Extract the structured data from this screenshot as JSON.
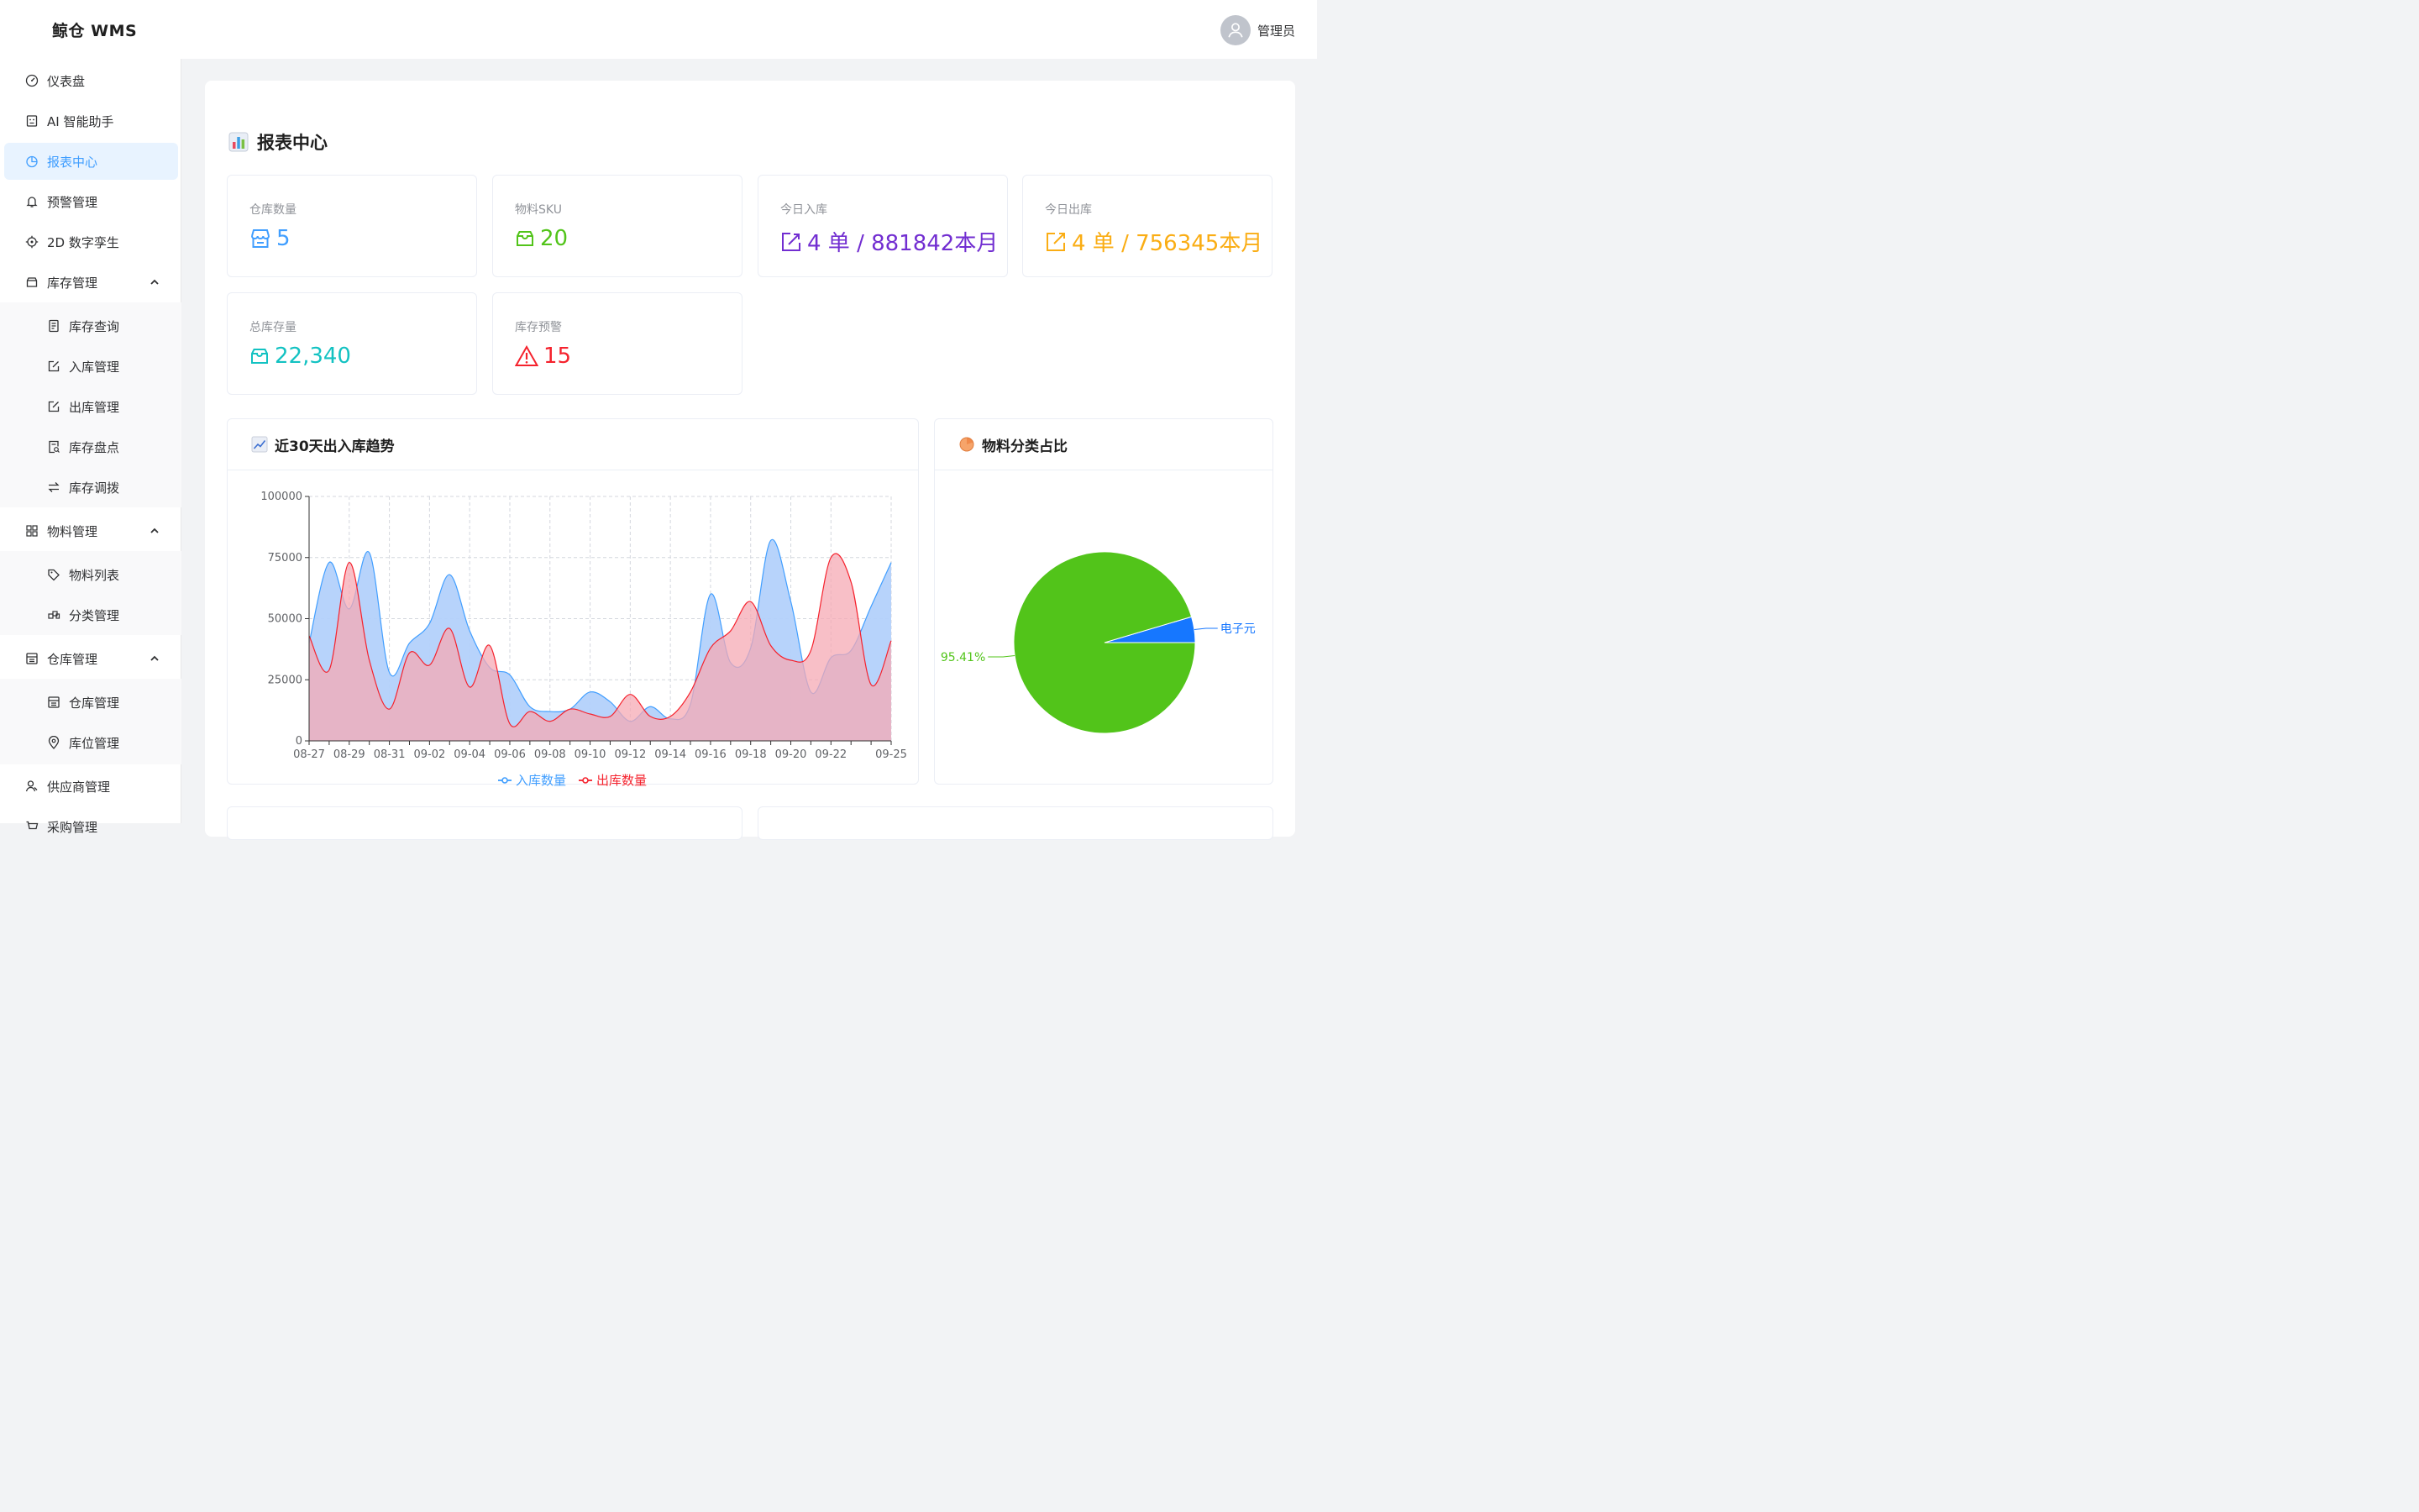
{
  "header": {
    "logo": "鲸仓 WMS",
    "user_name": "管理员"
  },
  "sidebar": {
    "items": [
      {
        "label": "仪表盘",
        "icon": "dashboard-icon"
      },
      {
        "label": "AI 智能助手",
        "icon": "robot-icon"
      },
      {
        "label": "报表中心",
        "icon": "pie-chart-icon",
        "active": true
      },
      {
        "label": "预警管理",
        "icon": "bell-icon"
      },
      {
        "label": "2D 数字孪生",
        "icon": "target-icon"
      },
      {
        "label": "库存管理",
        "icon": "box-icon",
        "expanded": true
      },
      {
        "label": "物料管理",
        "icon": "grid-icon",
        "expanded": true
      },
      {
        "label": "仓库管理",
        "icon": "warehouse-icon",
        "expanded": true
      },
      {
        "label": "供应商管理",
        "icon": "user-icon"
      },
      {
        "label": "采购管理",
        "icon": "cart-icon"
      }
    ],
    "inventory_sub": [
      {
        "label": "库存查询",
        "icon": "document-icon"
      },
      {
        "label": "入库管理",
        "icon": "edit-icon"
      },
      {
        "label": "出库管理",
        "icon": "edit-icon"
      },
      {
        "label": "库存盘点",
        "icon": "document-search-icon"
      },
      {
        "label": "库存调拨",
        "icon": "swap-icon"
      }
    ],
    "material_sub": [
      {
        "label": "物料列表",
        "icon": "tag-icon"
      },
      {
        "label": "分类管理",
        "icon": "category-icon"
      }
    ],
    "warehouse_sub": [
      {
        "label": "仓库管理",
        "icon": "warehouse-icon"
      },
      {
        "label": "库位管理",
        "icon": "location-icon"
      }
    ]
  },
  "page": {
    "title": "报表中心",
    "title_icon": "bar-chart-emoji-icon"
  },
  "stats": [
    {
      "label": "仓库数量",
      "value": "5",
      "icon": "shop-icon",
      "color": "#409eff"
    },
    {
      "label": "物料SKU",
      "value": "20",
      "icon": "box-icon",
      "color": "#52c41a"
    },
    {
      "label": "今日入库",
      "value": "4 单 / 881842本月",
      "icon": "edit-icon",
      "color": "#722ed1"
    },
    {
      "label": "今日出库",
      "value": "4 单 / 756345本月",
      "icon": "export-icon",
      "color": "#faad14"
    },
    {
      "label": "总库存量",
      "value": "22,340",
      "icon": "inbox-icon",
      "color": "#13c2c2"
    },
    {
      "label": "库存预警",
      "value": "15",
      "icon": "warning-icon",
      "color": "#f5222d"
    }
  ],
  "trend_panel": {
    "title": "近30天出入库趋势",
    "icon": "line-chart-emoji-icon"
  },
  "pie_panel": {
    "title": "物料分类占比",
    "icon": "pie-emoji-icon"
  },
  "chart_data": [
    {
      "type": "area",
      "title": "近30天出入库趋势",
      "x": [
        "08-27",
        "08-28",
        "08-29",
        "08-30",
        "08-31",
        "09-01",
        "09-02",
        "09-03",
        "09-04",
        "09-05",
        "09-06",
        "09-07",
        "09-08",
        "09-09",
        "09-10",
        "09-11",
        "09-12",
        "09-13",
        "09-14",
        "09-15",
        "09-16",
        "09-17",
        "09-18",
        "09-19",
        "09-20",
        "09-21",
        "09-22",
        "09-23",
        "09-24",
        "09-25"
      ],
      "x_tick_labels": [
        "08-27",
        "08-29",
        "08-31",
        "09-02",
        "09-04",
        "09-06",
        "09-08",
        "09-10",
        "09-12",
        "09-14",
        "09-16",
        "09-18",
        "09-20",
        "09-22",
        "09-25"
      ],
      "ylim": [
        0,
        100000
      ],
      "y_ticks": [
        0,
        25000,
        50000,
        75000,
        100000
      ],
      "grid": true,
      "legend": "bottom",
      "series": [
        {
          "name": "入库数量",
          "color": "#409eff",
          "fill": "#b3d1fb",
          "values": [
            40000,
            73000,
            54000,
            77000,
            28000,
            40000,
            48000,
            68000,
            45000,
            30000,
            27000,
            14000,
            12000,
            13000,
            20000,
            16000,
            8000,
            14000,
            9000,
            15000,
            60000,
            32000,
            38000,
            82000,
            57000,
            20000,
            34000,
            37000,
            55000,
            73000
          ]
        },
        {
          "name": "出库数量",
          "color": "#f5222d",
          "fill": "#f6aab4",
          "values": [
            43000,
            29000,
            73000,
            33000,
            13000,
            36000,
            31000,
            46000,
            22000,
            39000,
            7000,
            12000,
            8000,
            13000,
            11000,
            10000,
            19000,
            10000,
            10000,
            20000,
            38000,
            45000,
            57000,
            39000,
            33000,
            37000,
            75000,
            65000,
            23000,
            41000
          ]
        }
      ]
    },
    {
      "type": "pie",
      "title": "物料分类占比",
      "slices": [
        {
          "name": "电子元",
          "percent": 4.59,
          "color": "#1677ff"
        },
        {
          "name": "",
          "percent": 95.41,
          "color": "#52c41a",
          "label_text": "95.41%"
        }
      ]
    }
  ]
}
